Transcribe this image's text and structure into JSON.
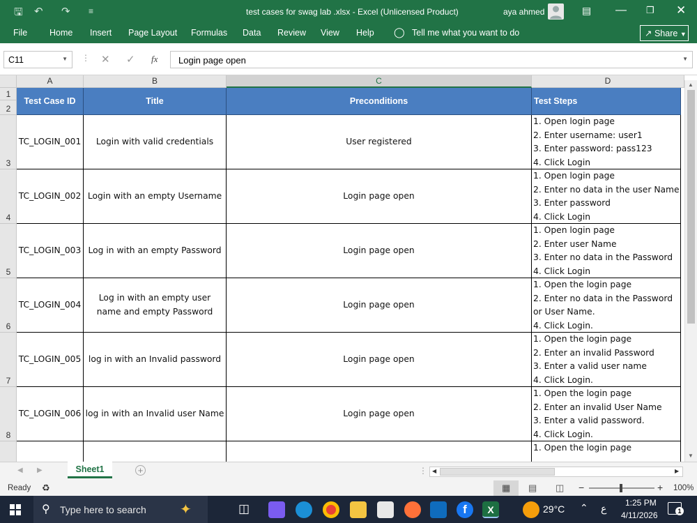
{
  "title_bar": {
    "document_title": "test cases for swag lab .xlsx  -  Excel (Unlicensed Product)",
    "user_name": "aya ahmed"
  },
  "ribbon": {
    "tabs": [
      "File",
      "Home",
      "Insert",
      "Page Layout",
      "Formulas",
      "Data",
      "Review",
      "View",
      "Help"
    ],
    "tell_me": "Tell me what you want to do",
    "share": "Share"
  },
  "formula_bar": {
    "name_box": "C11",
    "fx": "fx",
    "content": "Login page open"
  },
  "columns": [
    "A",
    "B",
    "C",
    "D"
  ],
  "rows": [
    "1",
    "2",
    "3",
    "4",
    "5",
    "6",
    "7",
    "8"
  ],
  "table": {
    "headers": [
      "Test Case ID",
      "Title",
      "Preconditions",
      "Test Steps"
    ],
    "rows": [
      {
        "id": "TC_LOGIN_001",
        "title": "Login with valid credentials",
        "pre": "User registered",
        "steps": [
          "1. Open login page",
          "2. Enter username: user1",
          "3. Enter password: pass123",
          "4. Click Login"
        ]
      },
      {
        "id": "TC_LOGIN_002",
        "title": "Login with an empty Username",
        "pre": "Login page open",
        "steps": [
          "1. Open login page",
          "2. Enter no data in the user Name",
          "3. Enter password",
          "4. Click Login"
        ]
      },
      {
        "id": "TC_LOGIN_003",
        "title": "Log in with an empty Password",
        "pre": "Login page open",
        "steps": [
          "1. Open login page",
          "2. Enter user Name",
          "3. Enter no data in the Password",
          "4. Click Login"
        ]
      },
      {
        "id": "TC_LOGIN_004",
        "title": "Log in with an empty user name and empty Password",
        "pre": "Login page open",
        "steps": [
          "1. Open the login page",
          "2. Enter no data in the Password",
          "or User Name.",
          "4. Click Login."
        ]
      },
      {
        "id": "TC_LOGIN_005",
        "title": "log in with an Invalid password",
        "pre": "Login page open",
        "steps": [
          "1. Open the login page",
          "2. Enter an invalid Password",
          "3. Enter a valid user name",
          "4. Click Login."
        ]
      },
      {
        "id": "TC_LOGIN_006",
        "title": "log in with an Invalid user Name",
        "pre": "Login page open",
        "steps": [
          "1. Open the login page",
          "2. Enter an invalid User Name",
          "3. Enter a valid password.",
          "4. Click Login."
        ]
      },
      {
        "id": "",
        "title": "",
        "pre": "",
        "steps": [
          "1. Open the login page",
          ""
        ]
      }
    ]
  },
  "sheet_tabs": [
    "Sheet1"
  ],
  "status": {
    "ready": "Ready",
    "zoom": "100%"
  },
  "taskbar": {
    "search_placeholder": "Type here to search",
    "weather": "29°C",
    "time": "1:25 PM",
    "date": "4/11/2026",
    "lang": "ع",
    "notifications": "1"
  },
  "colors": {
    "excel_green": "#217346",
    "header_fill": "#4a7ec1"
  }
}
